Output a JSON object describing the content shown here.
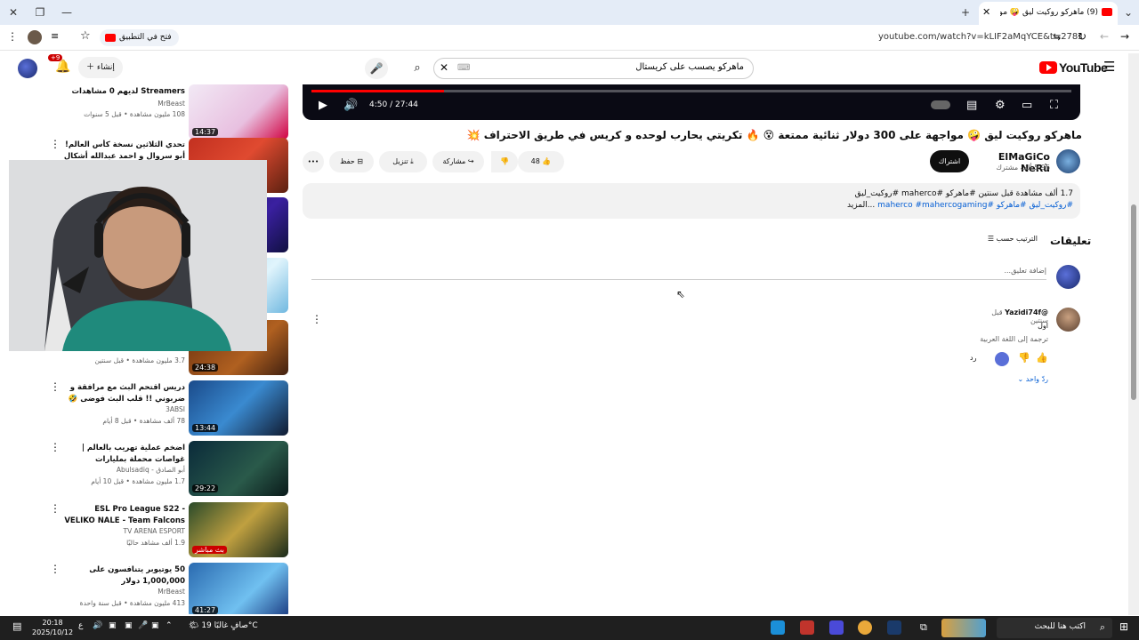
{
  "browser": {
    "active_tab_title": "(9) ماهركو روكيت ليق 🤪 مواجهة",
    "url": "youtube.com/watch?v=kLIF2aMqYCE&t=278s",
    "open_in_app": "فتح في التطبيق"
  },
  "yt_header": {
    "logo_text": "YouTube",
    "search_value": "ماهركو يصسب على كريستال",
    "create_label": "إنشاء",
    "notif_count": "+9"
  },
  "player": {
    "time": "4:50 / 27:44",
    "progress": 0.175
  },
  "video": {
    "title": "ماهركو روكيت ليق 🤪 مواجهة على 300 دولار ثنائية ممتعة 😵 🔥 تكريتي يحارب لوحده و كريس في طريق الاحتراف 💥",
    "channel_name": "ElMaGiCo NeRù",
    "channel_subs": "5.96 ألف مشترك",
    "subscribe_label": "اشتراك",
    "likes": "48",
    "share_label": "مشاركة",
    "download_label": "تنزيل",
    "save_label": "حفظ",
    "more_label": "•••"
  },
  "description": {
    "line1": "1.7 ألف مشاهدة قبل سنتين #ماهركو #maherco #روكيت_ليق",
    "line2": "#روكيت_ليق #ماهركو #maherco #mahercogaming",
    "more": "...المزيد"
  },
  "comments": {
    "title": "تعليقات",
    "sort_label": "الترتيب حسب",
    "add_placeholder": "إضافة تعليق...",
    "items": [
      {
        "author": "@Yazidi74f",
        "time": "قبل سنتين",
        "text": "اول",
        "translate": "ترجمة إلى اللغة العربية",
        "reply_label": "رد",
        "replies": "ردّ واحد"
      }
    ]
  },
  "sidebar": {
    "items": [
      {
        "title": "Streamers لديهم 0 مشاهدات",
        "channel": "MrBeast",
        "meta": "108 مليون مشاهدة • قبل 5 سنوات",
        "duration": "14:37"
      },
      {
        "title": "تحدي الثلاثين نسخة كأس العالم! أبو سروال و احمد عبدالله أشكال 😂",
        "channel": "",
        "meta": "",
        "duration": ""
      },
      {
        "title": "",
        "channel": "",
        "meta": "3.7 مليون مشاهدة • قبل سنتين",
        "duration": "24:38"
      },
      {
        "title": "دريس اقتحم البث مع مرافقة و ضربوني !! قلب البث فوضى 🤣",
        "channel": "3ABSI",
        "meta": "78 ألف مشاهدة • قبل 8 أيام",
        "duration": "13:44"
      },
      {
        "title": "اضخم عملية تهريب بالعالم | غواصات محملة بمليارات الدولارات",
        "channel": "أبو الصادق - Abulsadiq",
        "meta": "1.7 مليون مشاهدة • قبل 10 أيام",
        "duration": "29:22"
      },
      {
        "title": "ESL Pro League S22 - VELIKO NALE - Team Falcons vs Team...",
        "channel": "TV ARENA ESPORT",
        "meta": "1.9 ألف مشاهد حاليًا",
        "duration": "بث مباشر"
      },
      {
        "title": "50 يوتيوبر يتنافسون على 1,000,000 دولار",
        "channel": "MrBeast",
        "meta": "413 مليون مشاهدة • قبل سنة واحدة",
        "duration": "41:27"
      }
    ]
  },
  "taskbar": {
    "search_placeholder": "اكتب هنا للبحث",
    "weather": "صافٍ غالبًا 19°C",
    "time": "20:18",
    "date": "2025/10/12"
  }
}
